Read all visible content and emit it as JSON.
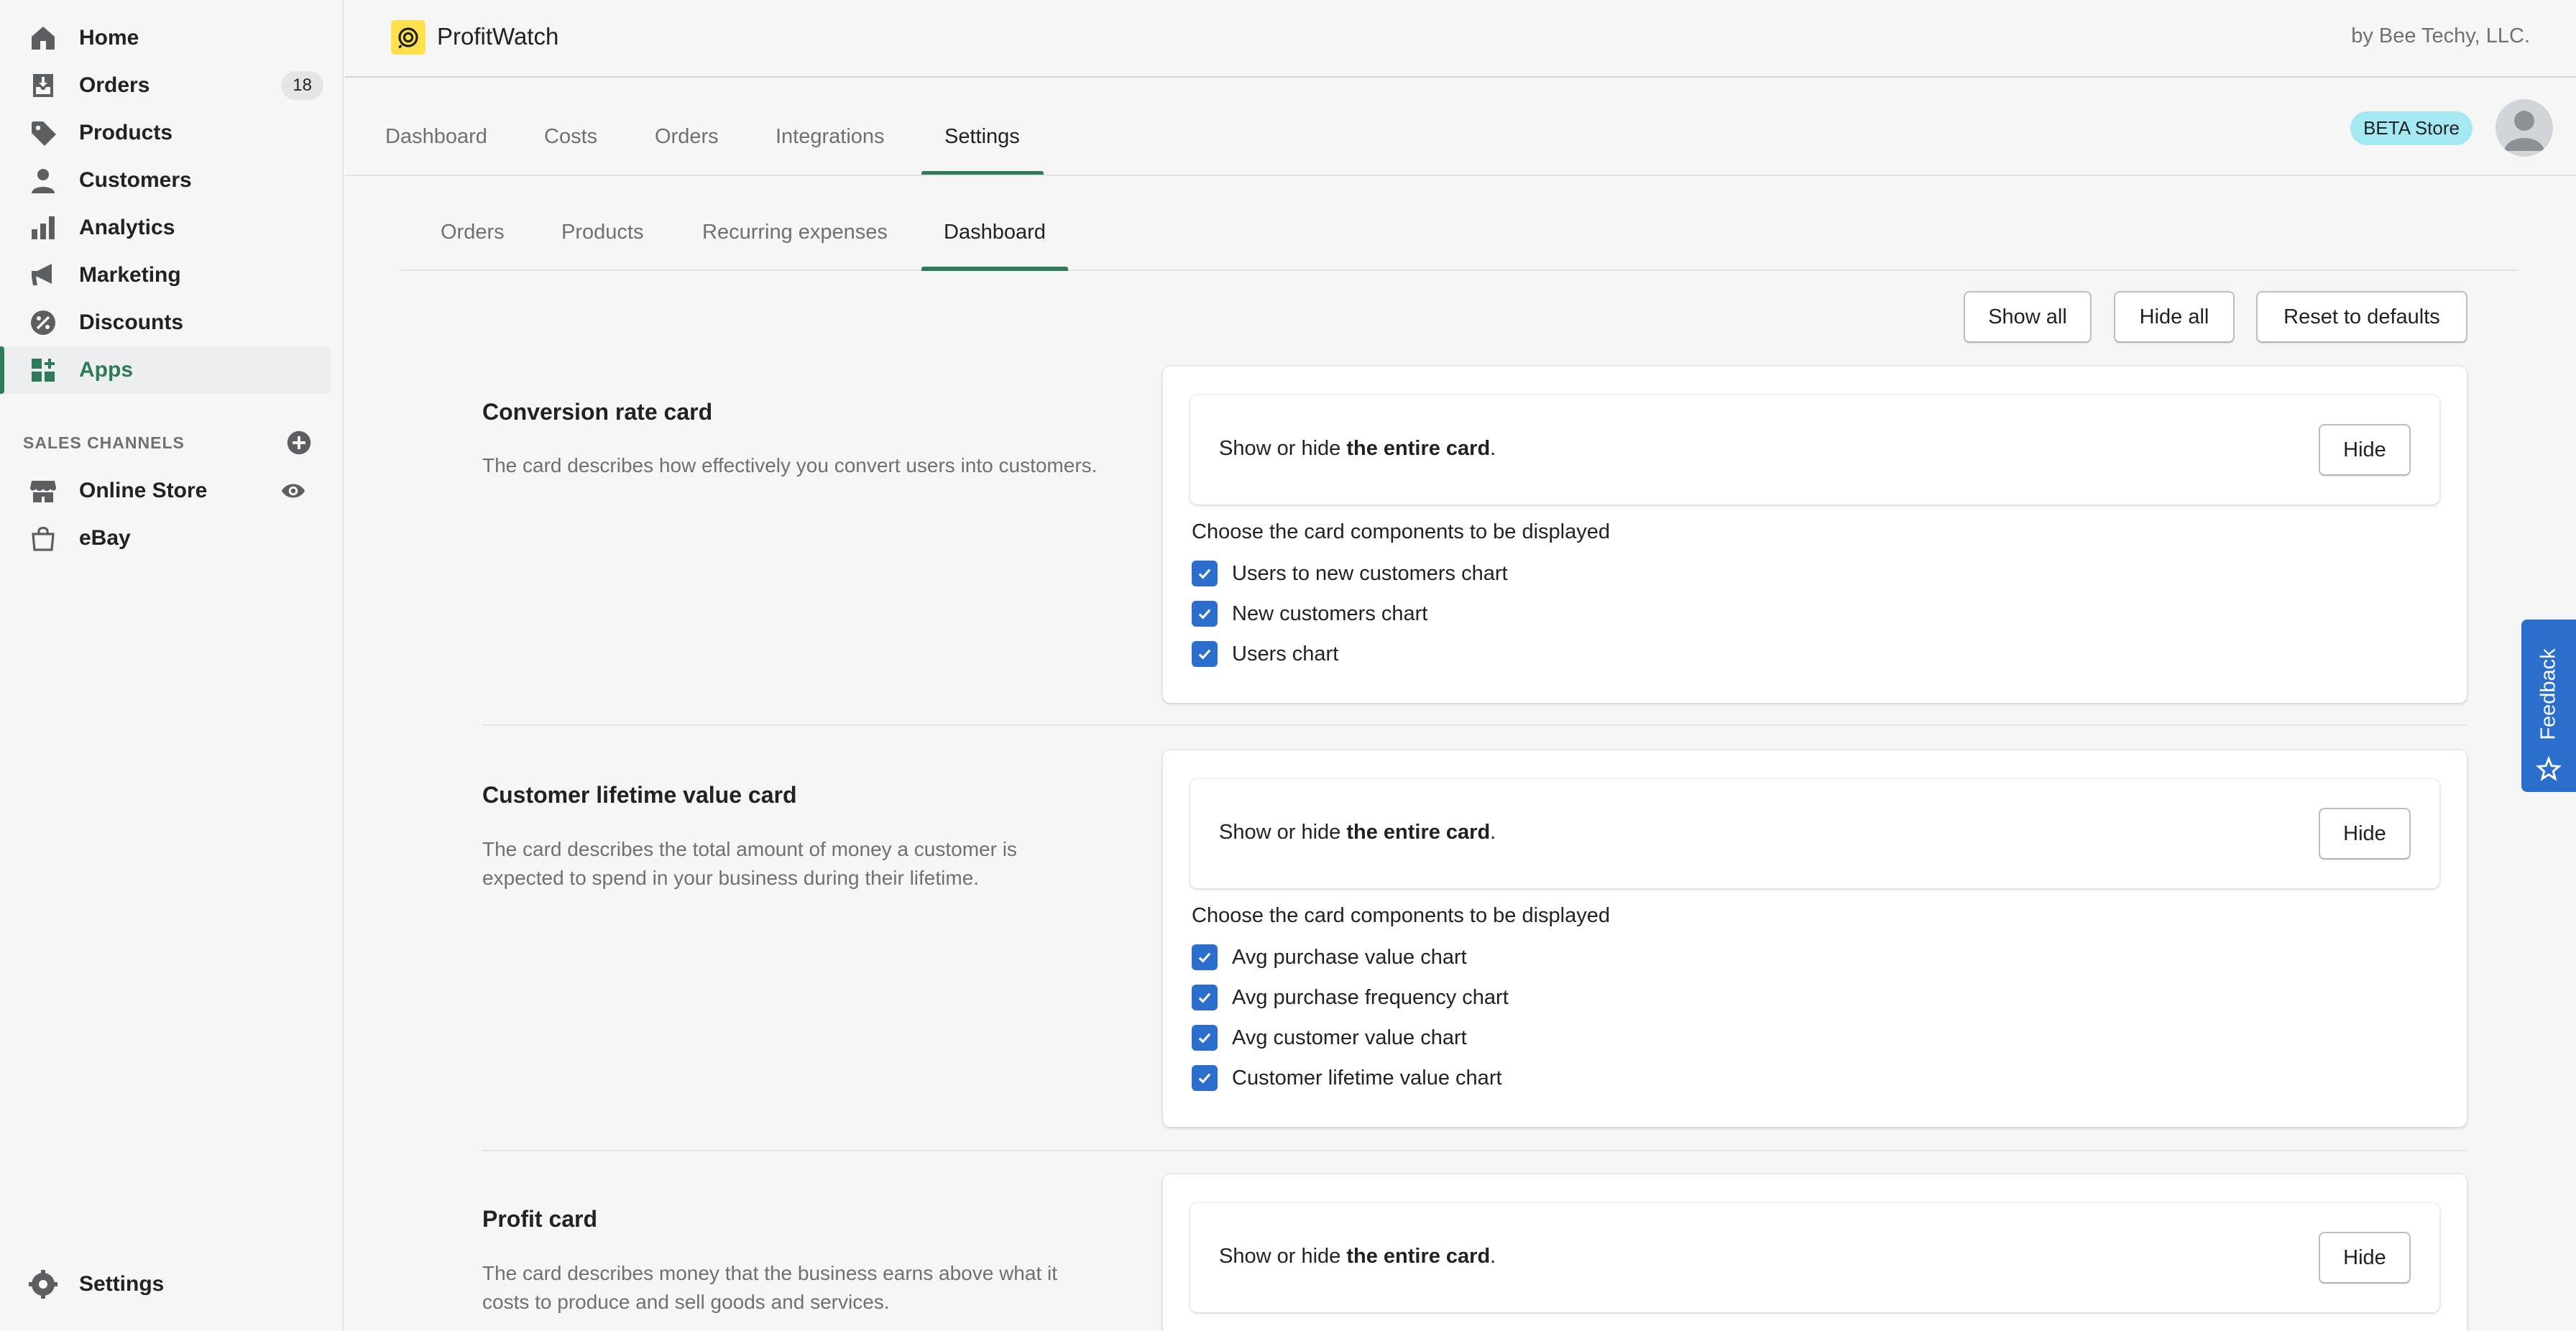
{
  "sidebar": {
    "items": [
      {
        "label": "Home",
        "icon": "home-icon"
      },
      {
        "label": "Orders",
        "icon": "orders-icon",
        "badge": "18"
      },
      {
        "label": "Products",
        "icon": "tag-icon"
      },
      {
        "label": "Customers",
        "icon": "person-icon"
      },
      {
        "label": "Analytics",
        "icon": "bar-chart-icon"
      },
      {
        "label": "Marketing",
        "icon": "megaphone-icon"
      },
      {
        "label": "Discounts",
        "icon": "discount-icon"
      },
      {
        "label": "Apps",
        "icon": "apps-icon",
        "active": true
      }
    ],
    "sales_channels_heading": "SALES CHANNELS",
    "channels": [
      {
        "label": "Online Store",
        "icon": "store-icon"
      },
      {
        "label": "eBay",
        "icon": "bag-icon"
      }
    ],
    "settings_label": "Settings"
  },
  "header": {
    "app_title": "ProfitWatch",
    "byline": "by Bee Techy, LLC."
  },
  "main_tabs": {
    "items": [
      "Dashboard",
      "Costs",
      "Orders",
      "Integrations",
      "Settings"
    ],
    "active": "Settings",
    "store_badge": "BETA Store"
  },
  "sub_tabs": {
    "items": [
      "Orders",
      "Products",
      "Recurring expenses",
      "Dashboard"
    ],
    "active": "Dashboard"
  },
  "toolbar": {
    "show_all": "Show all",
    "hide_all": "Hide all",
    "reset": "Reset to defaults"
  },
  "common": {
    "show_hide_prefix": "Show or hide ",
    "show_hide_bold": "the entire card",
    "show_hide_suffix": ".",
    "hide_button": "Hide",
    "components_label": "Choose the card components to be displayed"
  },
  "sections": [
    {
      "title": "Conversion rate card",
      "description": "The card describes how effectively you convert users into customers.",
      "components": [
        {
          "label": "Users to new customers chart",
          "checked": true
        },
        {
          "label": "New customers chart",
          "checked": true
        },
        {
          "label": "Users chart",
          "checked": true
        }
      ]
    },
    {
      "title": "Customer lifetime value card",
      "description": "The card describes the total amount of money a customer is expected to spend in your business during their lifetime.",
      "components": [
        {
          "label": "Avg purchase value chart",
          "checked": true
        },
        {
          "label": "Avg purchase frequency chart",
          "checked": true
        },
        {
          "label": "Avg customer value chart",
          "checked": true
        },
        {
          "label": "Customer lifetime value chart",
          "checked": true
        }
      ]
    },
    {
      "title": "Profit card",
      "description": "The card describes money that the business earns above what it costs to produce and sell goods and services."
    }
  ],
  "feedback": {
    "label": "Feedback"
  },
  "colors": {
    "accent": "#2f7a58",
    "checkbox": "#2c6ecb",
    "feedback": "#2c6ecb",
    "badge": "#a4e8f2",
    "logo": "#ffe14d"
  }
}
